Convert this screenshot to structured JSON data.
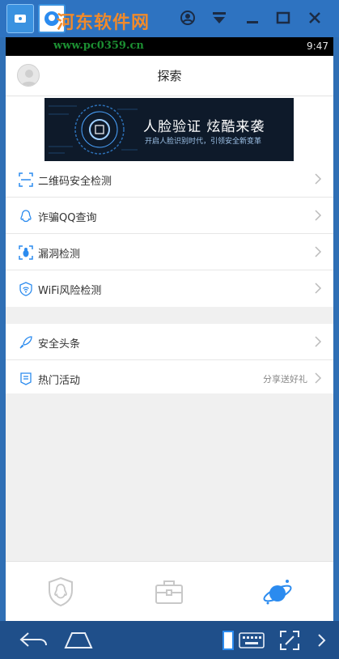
{
  "window": {
    "watermark": "河东软件网",
    "watermark_url": "www.pc0359.cn",
    "controls": [
      "account-icon",
      "dropdown-icon",
      "minimize-icon",
      "maximize-icon",
      "close-icon"
    ]
  },
  "statusbar": {
    "time": "9:47"
  },
  "header": {
    "title": "探索"
  },
  "banner": {
    "headline": "人脸验证  炫酷来袭",
    "subline": "开启人脸识别时代，引领安全新变革"
  },
  "menu_group_1": [
    {
      "label": "二维码安全检测",
      "icon": "qr-scan-icon"
    },
    {
      "label": "诈骗QQ查询",
      "icon": "qq-icon"
    },
    {
      "label": "漏洞检测",
      "icon": "bug-icon"
    },
    {
      "label": "WiFi风险检测",
      "icon": "wifi-shield-icon"
    }
  ],
  "menu_group_2": [
    {
      "label": "安全头条",
      "icon": "rocket-icon",
      "hint": ""
    },
    {
      "label": "热门活动",
      "icon": "list-icon",
      "hint": "分享送好礼"
    }
  ],
  "bottom_nav": [
    "shield-qq-icon",
    "toolbox-icon",
    "planet-icon"
  ],
  "colors": {
    "accent": "#2b8bef",
    "titlebar": "#2e73c1",
    "emubar": "#1f4f8a"
  }
}
